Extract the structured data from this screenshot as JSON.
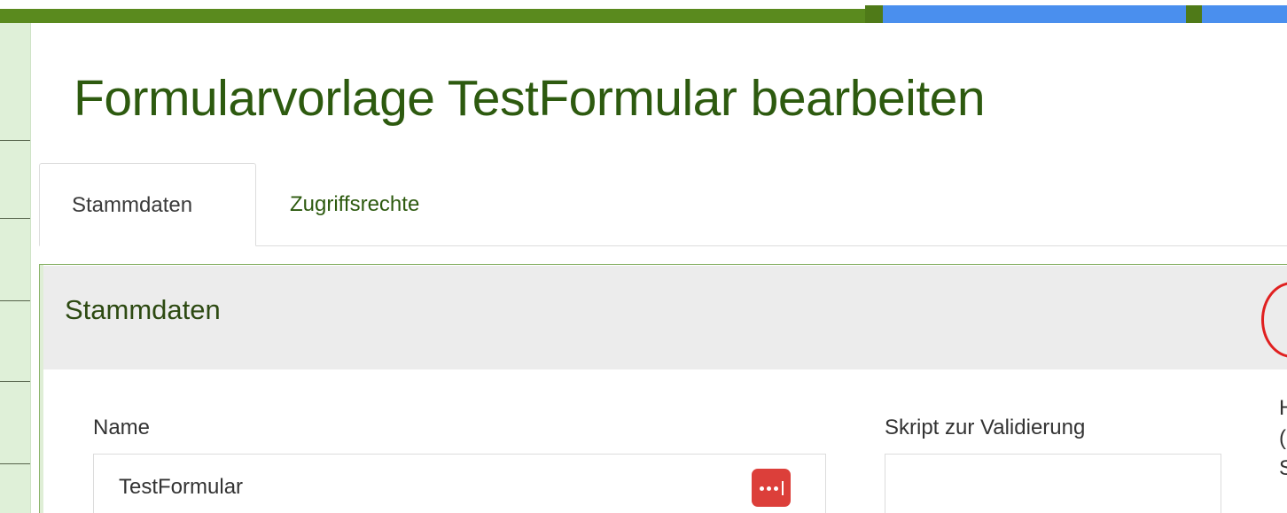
{
  "page": {
    "title": "Formularvorlage TestFormular bearbeiten"
  },
  "tabs": [
    {
      "label": "Stammdaten",
      "active": true
    },
    {
      "label": "Zugriffsrechte",
      "active": false
    }
  ],
  "panel": {
    "title": "Stammdaten",
    "fields": {
      "name_label": "Name",
      "name_value": "TestFormular",
      "script_label": "Skript zur Validierung",
      "script_value": ""
    },
    "side_text": [
      "H",
      "(",
      "S"
    ]
  },
  "icons": {
    "password_manager": "password-manager-icon"
  },
  "colors": {
    "brand_green": "#2d5a0f",
    "topbar_green": "#5a8a1e",
    "topbar_blue": "#4a8fee",
    "sidebar_bg": "#dff0d8",
    "panel_heading_bg": "#ececec",
    "annotation_red": "#e02020",
    "icon_red": "#dc3f3a"
  }
}
